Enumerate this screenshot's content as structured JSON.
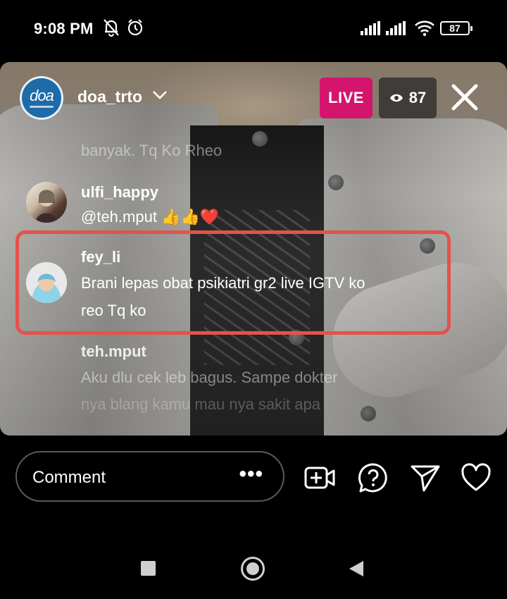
{
  "status_bar": {
    "time": "9:08 PM",
    "battery": "87",
    "icons": [
      "bell-off-icon",
      "alarm-icon",
      "signal-icon",
      "signal-icon",
      "wifi-icon",
      "battery-icon"
    ]
  },
  "live": {
    "host_username": "doa_trto",
    "live_label": "LIVE",
    "viewer_count": "87",
    "live_color": "#d3156d"
  },
  "comments": [
    {
      "username": "",
      "text": "banyak. Tq Ko Rheo",
      "faded": true
    },
    {
      "username": "ulfi_happy",
      "text": "@teh.mput 👍👍❤️",
      "faded": false
    },
    {
      "username": "fey_li",
      "text_line1": "Brani lepas obat psikiatri gr2 live IGTV ko",
      "text_line2": "reo Tq ko",
      "highlighted": true,
      "highlight_color": "#e5524a"
    },
    {
      "username": "teh.mput",
      "text_line1": "Aku dlu cek leb bagus. Sampe dokter",
      "text_line2": "nya blang kamu mau nya sakit apa",
      "faded": true
    }
  ],
  "comment_input": {
    "placeholder": "Comment",
    "more_label": "•••"
  },
  "actions": [
    "add-video-icon",
    "question-icon",
    "send-icon",
    "heart-icon"
  ],
  "nav": [
    "recents-button",
    "home-button",
    "back-button"
  ]
}
